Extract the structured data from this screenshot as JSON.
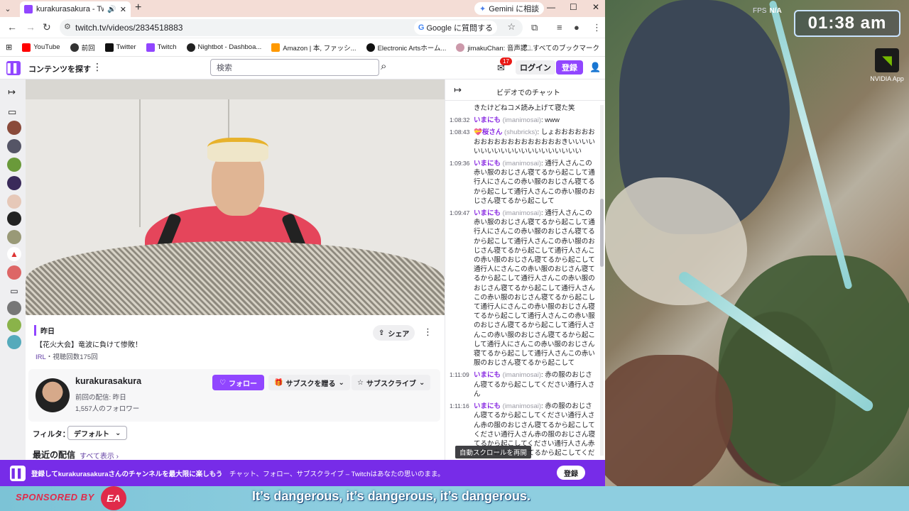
{
  "browser": {
    "tab_title": "kurakurasakura - Twitch",
    "gemini_label": "Gemini に相談",
    "url": "twitch.tv/videos/2834518883",
    "google_chip": "Google に質問する",
    "bookmarks": [
      "YouTube",
      "前回",
      "Twitter",
      "Twitch",
      "Nightbot - Dashboa...",
      "Amazon | 本, ファッシ...",
      "Electronic Artsホーム...",
      "jimakuChan: 音声認..."
    ],
    "all_bookmarks": "すべてのブックマーク"
  },
  "twitch_header": {
    "browse": "コンテンツを探す",
    "search_placeholder": "検索",
    "badge_count": "17",
    "login": "ログイン",
    "signup": "登録"
  },
  "video_info": {
    "date": "昨日",
    "title": "【花火大会】竜波に負けて惨敗！",
    "category": "IRL",
    "views": "・視聴回数175回",
    "share": "シェア"
  },
  "channel": {
    "name": "kurakurasakura",
    "last_live": "前回の配信: 昨日",
    "followers": "1,557人のフォロワー",
    "follow": "フォロー",
    "gift": "サブスクを贈る",
    "subscribe": "サブスクライブ"
  },
  "filters": {
    "label": "フィルタ：",
    "value": "デフォルト",
    "recent": "最近の配信",
    "see_all": "すべて表示 ›"
  },
  "chat": {
    "title": "ビデオでのチャット",
    "resume": "自動スクロールを再開",
    "messages": [
      {
        "ts": "",
        "name": "",
        "login": "",
        "text": "きたけどねコメ読み上げて寝た笑"
      },
      {
        "ts": "1:08:32",
        "name": "いまにも",
        "login": "(imanimosai)",
        "text": ": www"
      },
      {
        "ts": "1:08:43",
        "name": "💝桜さん",
        "login": "(shubricks)",
        "text": ": しょおおおおおおおおおおおおおおおおおおおきいいいいいいいいいいいいいいいいいいいい"
      },
      {
        "ts": "1:09:36",
        "name": "いまにも",
        "login": "(imanimosai)",
        "text": ": 通行人さんこの赤い服のおじさん寝てるから起こして通行人にさんこの赤い服のおじさん寝てるから起こして通行人さんこの赤い服のおじさん寝てるから起こして"
      },
      {
        "ts": "1:09:47",
        "name": "いまにも",
        "login": "(imanimosai)",
        "text": ": 通行人さんこの赤い服のおじさん寝てるから起こして通行人にさんこの赤い服のおじさん寝てるから起こして通行人さんこの赤い服のおじさん寝てるから起こして通行人さんこの赤い服のおじさん寝てるから起こして通行人にさんこの赤い服のおじさん寝てるから起こして通行人さんこの赤い服のおじさん寝てるから起こして通行人さんこの赤い服のおじさん寝てるから起こして通行人にさんこの赤い服のおじさん寝てるから起こして通行人さんこの赤い服のおじさん寝てるから起こして通行人さんこの赤い服のおじさん寝てるから起こして通行人にさんこの赤い服のおじさん寝てるから起こして通行人さんこの赤い服のおじさん寝てるから起こして"
      },
      {
        "ts": "1:11:09",
        "name": "いまにも",
        "login": "(imanimosai)",
        "text": ": 赤の服のおじさん寝てるから起こしてください通行人さん"
      },
      {
        "ts": "1:11:16",
        "name": "いまにも",
        "login": "(imanimosai)",
        "text": ": 赤の服のおじさん寝てるから起こしてください通行人さん赤の服のおじさん寝てるから起こしてください通行人さん赤の服のおじさん寝てるから起こしてください通行人さん赤の服のおじさん寝てるから起こしてくだ"
      }
    ]
  },
  "banner": {
    "bold": "登録してkurakurasakuraさんのチャンネルを最大限に楽しもう",
    "rest": "チャット、フォロー、サブスクライブ – Twitchはあなたの思いのまま。",
    "button": "登録"
  },
  "overlay": {
    "clock": "01:38 am",
    "fps_label": "FPS",
    "fps_value": "N/A",
    "nvidia": "NVIDIA App",
    "sponsored": "SPONSORED BY",
    "ea": "EA",
    "subtitle": "It’s dangerous, it’s dangerous, it’s dangerous."
  },
  "colors": {
    "twitch_purple": "#9146ff",
    "banner_purple": "#772ce8",
    "chat_name": "#8a2be2",
    "ea_red": "#e02a4a"
  }
}
